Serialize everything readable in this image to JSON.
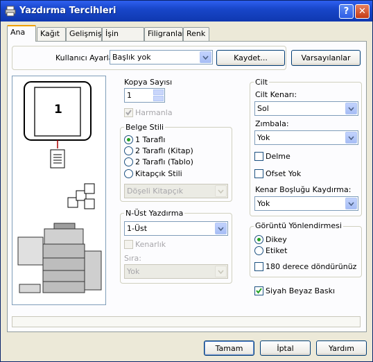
{
  "window": {
    "title": "Yazdırma Tercihleri",
    "help_label": "?",
    "close_label": "✕"
  },
  "tabs": [
    "Ana",
    "Kağıt",
    "Gelişmiş",
    "İşin İdaresi",
    "Filigranlar",
    "Renk"
  ],
  "user_settings": {
    "label": "Kullanıcı Ayarları:",
    "value": "Başlık yok",
    "save_label": "Kaydet...",
    "defaults_label": "Varsayılanlar"
  },
  "preview": {
    "page_number": "1"
  },
  "copies": {
    "label": "Kopya Sayısı",
    "value": "1",
    "collate_label": "Harmanla",
    "collate_checked": true
  },
  "document_style": {
    "label": "Belge Stili",
    "options": [
      "1 Taraflı",
      "2 Taraflı (Kitap)",
      "2 Taraflı (Tablo)",
      "Kitapçık Stili"
    ],
    "selected": 0,
    "booklet_value": "Döşeli Kitapçık"
  },
  "n_up": {
    "label": "N-Üst Yazdırma",
    "value": "1-Üst",
    "border_label": "Kenarlık",
    "order_label": "Sıra:",
    "order_value": "Yok"
  },
  "binding": {
    "label": "Cilt",
    "edge_label": "Cilt Kenarı:",
    "edge_value": "Sol",
    "staple_label": "Zımbala:",
    "staple_value": "Yok",
    "punch_label": "Delme",
    "offset_label": "Ofset Yok",
    "margin_shift_label": "Kenar Boşluğu Kaydırma:",
    "margin_shift_value": "Yok"
  },
  "orientation": {
    "label": "Görüntü Yönlendirmesi",
    "portrait_label": "Dikey",
    "landscape_label": "Etiket",
    "rotate_label": "180 derece döndürünüz"
  },
  "bw_print": {
    "label": "Siyah Beyaz Baskı",
    "checked": true
  },
  "footer": {
    "ok_label": "Tamam",
    "cancel_label": "İptal",
    "help_label": "Yardım"
  },
  "colors": {
    "title_bar": "#1846c9",
    "dialog_bg": "#ece9d8",
    "panel_bg": "#fcfcfe",
    "check_mark": "#21a121"
  }
}
